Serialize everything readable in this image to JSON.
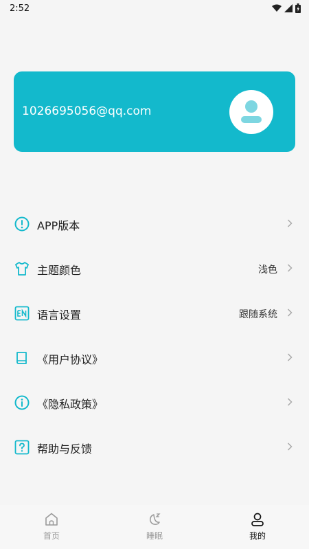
{
  "status_bar": {
    "time": "2:52"
  },
  "profile": {
    "email": "1026695056@qq.com"
  },
  "menu": [
    {
      "label": "APP版本",
      "value": "",
      "icon": "info-icon"
    },
    {
      "label": "主题颜色",
      "value": "浅色",
      "icon": "tshirt-icon"
    },
    {
      "label": "语言设置",
      "value": "跟随系统",
      "icon": "language-en-icon"
    },
    {
      "label": "《用户协议》",
      "value": "",
      "icon": "book-icon"
    },
    {
      "label": "《隐私政策》",
      "value": "",
      "icon": "info-circle-icon"
    },
    {
      "label": "帮助与反馈",
      "value": "",
      "icon": "help-icon"
    }
  ],
  "tabs": [
    {
      "label": "首页",
      "icon": "home-icon",
      "active": false
    },
    {
      "label": "睡眠",
      "icon": "moon-sleep-icon",
      "active": false
    },
    {
      "label": "我的",
      "icon": "person-icon",
      "active": true
    }
  ],
  "colors": {
    "accent": "#13b9cc",
    "background": "#f5f5f5"
  }
}
